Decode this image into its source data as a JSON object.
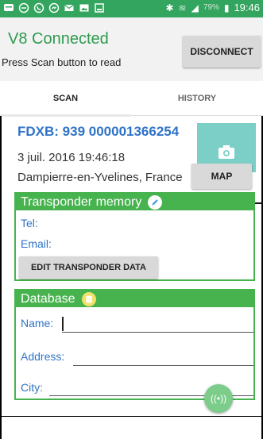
{
  "status_bar": {
    "battery_percent": "79%",
    "time": "19:46",
    "icons": [
      "message-icon",
      "minus-circle-icon",
      "whatsapp-icon",
      "chat-icon",
      "email-icon",
      "gallery-icon",
      "screenshot-icon",
      "bluetooth-icon",
      "wifi-icon",
      "signal-icon",
      "battery-icon"
    ]
  },
  "header": {
    "title": "V8 Connected",
    "subtitle": "Press Scan button to read",
    "disconnect_label": "DISCONNECT"
  },
  "tabs": [
    {
      "label": "SCAN",
      "selected": true
    },
    {
      "label": "HISTORY",
      "selected": false
    }
  ],
  "scan": {
    "fdxb": "FDXB: 939 000001366254",
    "date": "3 juil. 2016 19:46:18",
    "location": "Dampierre-en-Yvelines, France",
    "map_label": "MAP",
    "photo_icon": "camera-icon"
  },
  "transponder_memory": {
    "title": "Transponder memory",
    "icon": "pencil-icon",
    "tel_label": "Tel:",
    "email_label": "Email:",
    "edit_button_label": "EDIT TRANSPONDER DATA"
  },
  "database": {
    "title": "Database",
    "icon": "database-icon",
    "name_label": "Name:",
    "address_label": "Address:",
    "city_label": "City:"
  },
  "fab": {
    "icon": "nfc-icon",
    "symbol": "((•))"
  },
  "colors": {
    "status_bar": "#33a55e",
    "title_green": "#2e9a4f",
    "panel_green": "#47b34e",
    "link_blue": "#2f73c7",
    "photo_teal": "#7ccfc7",
    "fab_green": "#7ccc8a"
  }
}
